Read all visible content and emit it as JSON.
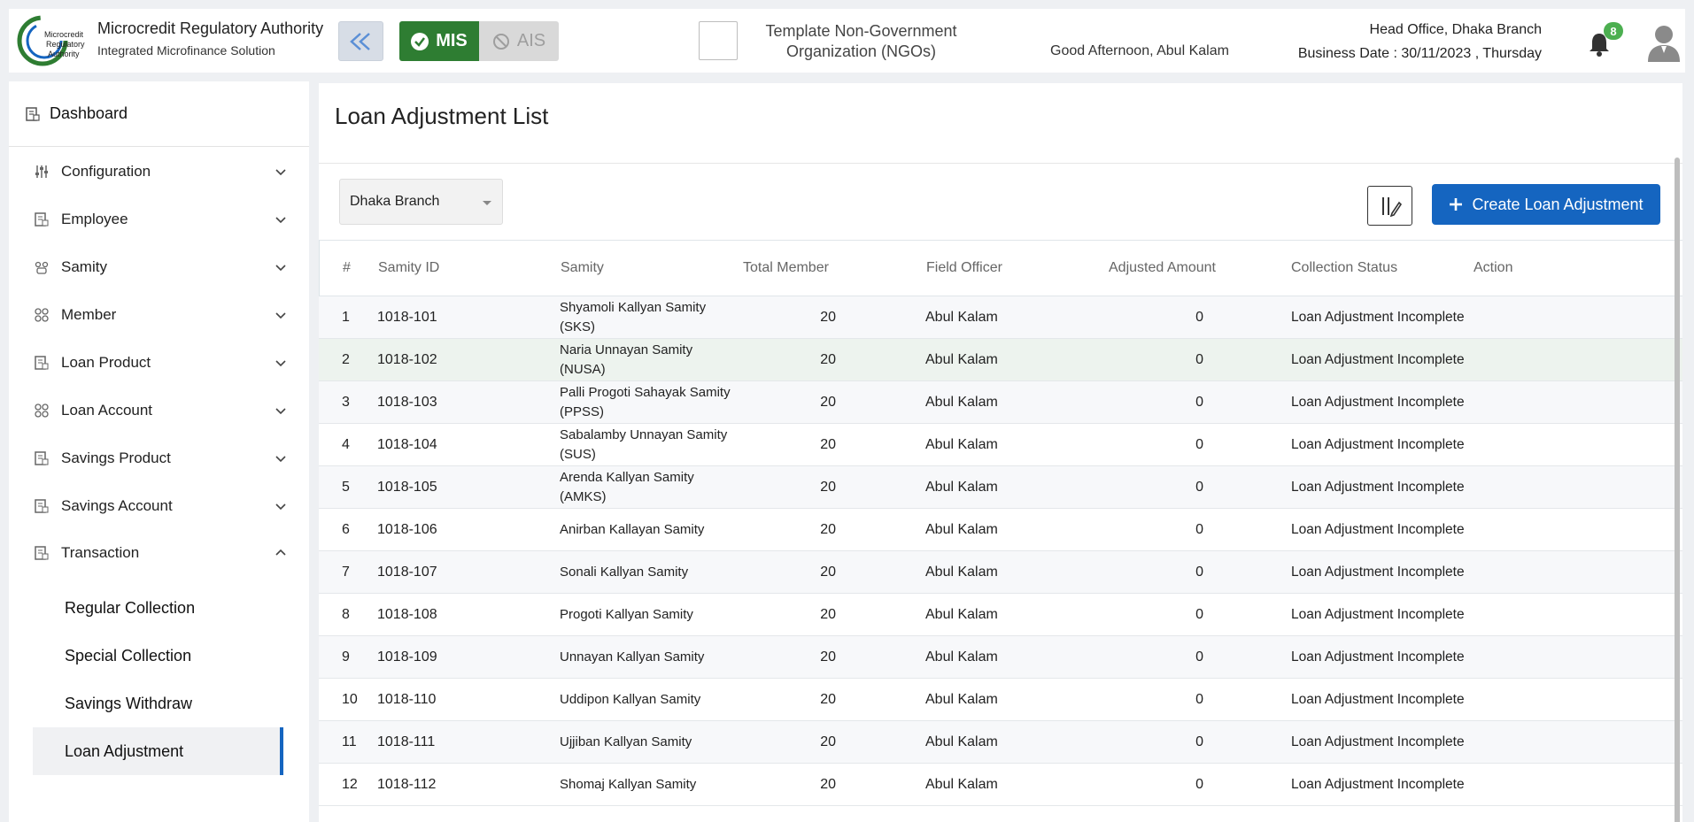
{
  "header": {
    "logo_text": [
      "Microcredit",
      "Regulatory",
      "Authority"
    ],
    "brand_title": "Microcredit Regulatory Authority",
    "brand_subtitle": "Integrated Microfinance Solution",
    "modes": {
      "mis": "MIS",
      "ais": "AIS"
    },
    "org_name": "Template Non-Government Organization (NGOs)",
    "greeting": "Good Afternoon, Abul Kalam",
    "branch_office": "Head Office, Dhaka Branch",
    "business_date": "Business Date : 30/11/2023 , Thursday",
    "notification_count": "8"
  },
  "sidebar": {
    "dashboard": "Dashboard",
    "items": [
      {
        "label": "Configuration",
        "icon": "sliders-icon"
      },
      {
        "label": "Employee",
        "icon": "doc-icon"
      },
      {
        "label": "Samity",
        "icon": "group-icon"
      },
      {
        "label": "Member",
        "icon": "members-icon"
      },
      {
        "label": "Loan Product",
        "icon": "doc-icon"
      },
      {
        "label": "Loan Account",
        "icon": "members-icon"
      },
      {
        "label": "Savings Product",
        "icon": "doc-icon"
      },
      {
        "label": "Savings Account",
        "icon": "doc-icon"
      },
      {
        "label": "Transaction",
        "icon": "doc-icon"
      }
    ],
    "sub_items": [
      "Regular Collection",
      "Special Collection",
      "Savings Withdraw",
      "Loan Adjustment"
    ]
  },
  "main": {
    "title": "Loan Adjustment List",
    "branch_select": "Dhaka Branch",
    "create_button": "Create Loan Adjustment",
    "columns": [
      "#",
      "Samity ID",
      "Samity",
      "Total Member",
      "Field Officer",
      "Adjusted Amount",
      "Collection Status",
      "Action"
    ],
    "rows": [
      {
        "idx": "1",
        "id": "1018-101",
        "samity": "Shyamoli Kallyan Samity (SKS)",
        "total": "20",
        "officer": "Abul Kalam",
        "amount": "0",
        "status": "Loan Adjustment Incomplete"
      },
      {
        "idx": "2",
        "id": "1018-102",
        "samity": "Naria Unnayan Samity (NUSA)",
        "total": "20",
        "officer": "Abul Kalam",
        "amount": "0",
        "status": "Loan Adjustment Incomplete"
      },
      {
        "idx": "3",
        "id": "1018-103",
        "samity": "Palli Progoti Sahayak Samity (PPSS)",
        "total": "20",
        "officer": "Abul Kalam",
        "amount": "0",
        "status": "Loan Adjustment Incomplete"
      },
      {
        "idx": "4",
        "id": "1018-104",
        "samity": "Sabalamby Unnayan Samity (SUS)",
        "total": "20",
        "officer": "Abul Kalam",
        "amount": "0",
        "status": "Loan Adjustment Incomplete"
      },
      {
        "idx": "5",
        "id": "1018-105",
        "samity": "Arenda Kallyan Samity (AMKS)",
        "total": "20",
        "officer": "Abul Kalam",
        "amount": "0",
        "status": "Loan Adjustment Incomplete"
      },
      {
        "idx": "6",
        "id": "1018-106",
        "samity": "Anirban Kallayan Samity",
        "total": "20",
        "officer": "Abul Kalam",
        "amount": "0",
        "status": "Loan Adjustment Incomplete"
      },
      {
        "idx": "7",
        "id": "1018-107",
        "samity": "Sonali Kallyan Samity",
        "total": "20",
        "officer": "Abul Kalam",
        "amount": "0",
        "status": "Loan Adjustment Incomplete"
      },
      {
        "idx": "8",
        "id": "1018-108",
        "samity": "Progoti Kallyan Samity",
        "total": "20",
        "officer": "Abul Kalam",
        "amount": "0",
        "status": "Loan Adjustment Incomplete"
      },
      {
        "idx": "9",
        "id": "1018-109",
        "samity": "Unnayan Kallyan Samity",
        "total": "20",
        "officer": "Abul Kalam",
        "amount": "0",
        "status": "Loan Adjustment Incomplete"
      },
      {
        "idx": "10",
        "id": "1018-110",
        "samity": "Uddipon Kallyan Samity",
        "total": "20",
        "officer": "Abul Kalam",
        "amount": "0",
        "status": "Loan Adjustment Incomplete"
      },
      {
        "idx": "11",
        "id": "1018-111",
        "samity": "Ujjiban Kallyan Samity",
        "total": "20",
        "officer": "Abul Kalam",
        "amount": "0",
        "status": "Loan Adjustment Incomplete"
      },
      {
        "idx": "12",
        "id": "1018-112",
        "samity": "Shomaj Kallyan Samity",
        "total": "20",
        "officer": "Abul Kalam",
        "amount": "0",
        "status": "Loan Adjustment Incomplete"
      }
    ]
  },
  "colors": {
    "primary": "#1565c0",
    "mis_green": "#2e7d32",
    "badge_green": "#4caf50"
  }
}
